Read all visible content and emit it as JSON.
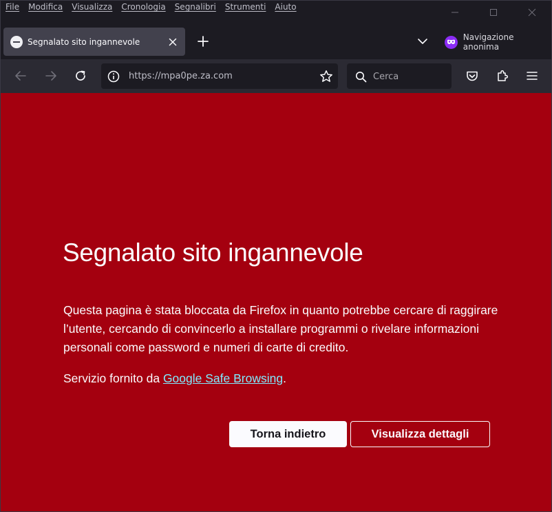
{
  "menubar": {
    "items": [
      "File",
      "Modifica",
      "Visualizza",
      "Cronologia",
      "Segnalibri",
      "Strumenti",
      "Aiuto"
    ]
  },
  "tab": {
    "title": "Segnalato sito ingannevole"
  },
  "private_browsing": {
    "label": "Navigazione anonima"
  },
  "urlbar": {
    "url": "https://mpa0pe.za.com"
  },
  "search": {
    "placeholder": "Cerca"
  },
  "page": {
    "title": "Segnalato sito ingannevole",
    "description": "Questa pagina è stata bloccata da Firefox in quanto potrebbe cercare di raggirare l’utente, cercando di convincerlo a installare programmi o rivelare informazioni personali come password e numeri di carte di credito.",
    "provider_prefix": "Servizio fornito da ",
    "provider_link": "Google Safe Browsing",
    "provider_suffix": ".",
    "back_button": "Torna indietro",
    "details_button": "Visualizza dettagli"
  },
  "colors": {
    "page_background": "#a4000f",
    "chrome_background": "#1c1b22",
    "toolbar_background": "#2b2a33",
    "link": "#80ebff",
    "private_accent": "#8b2cf5"
  }
}
